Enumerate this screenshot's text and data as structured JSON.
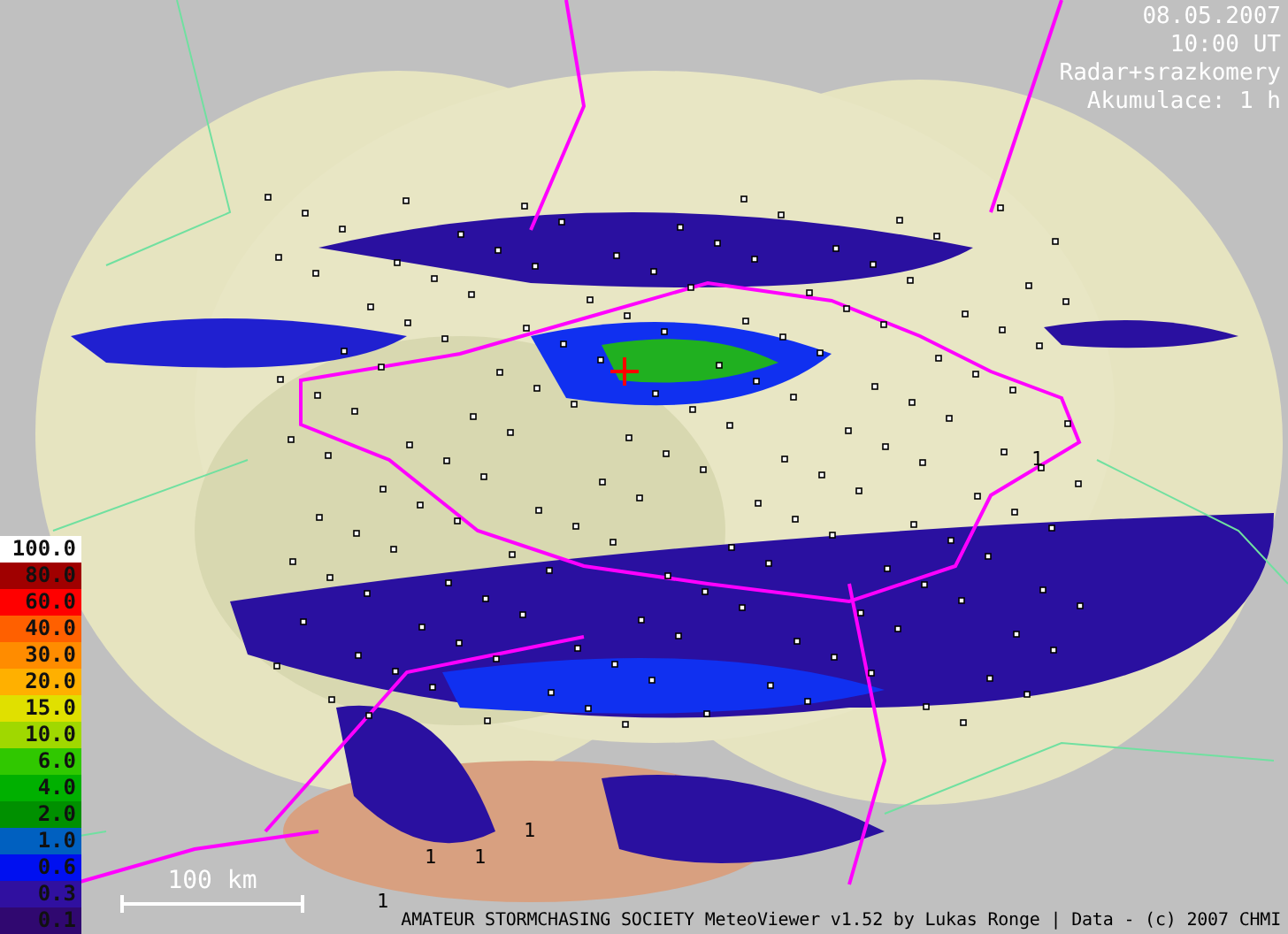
{
  "header": {
    "date": "08.05.2007",
    "time": "10:00 UT",
    "product": "Radar+srazkomery",
    "accumulation": "Akumulace: 1 h"
  },
  "legend": [
    {
      "label": "100.0",
      "color": "#ffffff"
    },
    {
      "label": "80.0",
      "color": "#a00000"
    },
    {
      "label": "60.0",
      "color": "#ff0000"
    },
    {
      "label": "40.0",
      "color": "#ff6000"
    },
    {
      "label": "30.0",
      "color": "#ff8c00"
    },
    {
      "label": "20.0",
      "color": "#ffb000"
    },
    {
      "label": "15.0",
      "color": "#e0e000"
    },
    {
      "label": "10.0",
      "color": "#a0d800"
    },
    {
      "label": "6.0",
      "color": "#30c800"
    },
    {
      "label": "4.0",
      "color": "#00b000"
    },
    {
      "label": "2.0",
      "color": "#009000"
    },
    {
      "label": "1.0",
      "color": "#0060c0"
    },
    {
      "label": "0.6",
      "color": "#0010f0"
    },
    {
      "label": "0.3",
      "color": "#3010a0"
    },
    {
      "label": "0.1",
      "color": "#300870"
    }
  ],
  "gauge_values": [
    "1",
    "1",
    "1",
    "1",
    "1"
  ],
  "scale_bar": {
    "label": "100 km"
  },
  "footer": "AMATEUR STORMCHASING SOCIETY MeteoViewer v1.52 by Lukas Ronge | Data - (c) 2007 CHMI"
}
